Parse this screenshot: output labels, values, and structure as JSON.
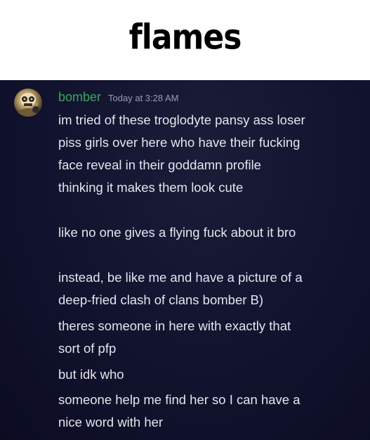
{
  "caption": "flames",
  "message": {
    "username": "bomber",
    "timestamp": "Today at 3:28 AM",
    "avatar_icon": "clash-of-clans-bomber-avatar",
    "lines": [
      "im tried of these troglodyte pansy ass loser",
      "piss girls over here who have their fucking",
      "face reveal in their goddamn profile",
      "thinking it makes them look cute",
      "like no one gives a flying fuck about it bro",
      "instead, be like me and have a picture of a",
      "deep-fried clash of clans bomber B)",
      "theres someone in here with exactly that",
      "sort of pfp",
      "but idk who",
      "someone help me find her so I can have a",
      "nice word with her"
    ]
  },
  "colors": {
    "username": "#3ba55d",
    "background": "#131430",
    "text": "#e4e5ec",
    "timestamp": "#9a9cb3"
  }
}
